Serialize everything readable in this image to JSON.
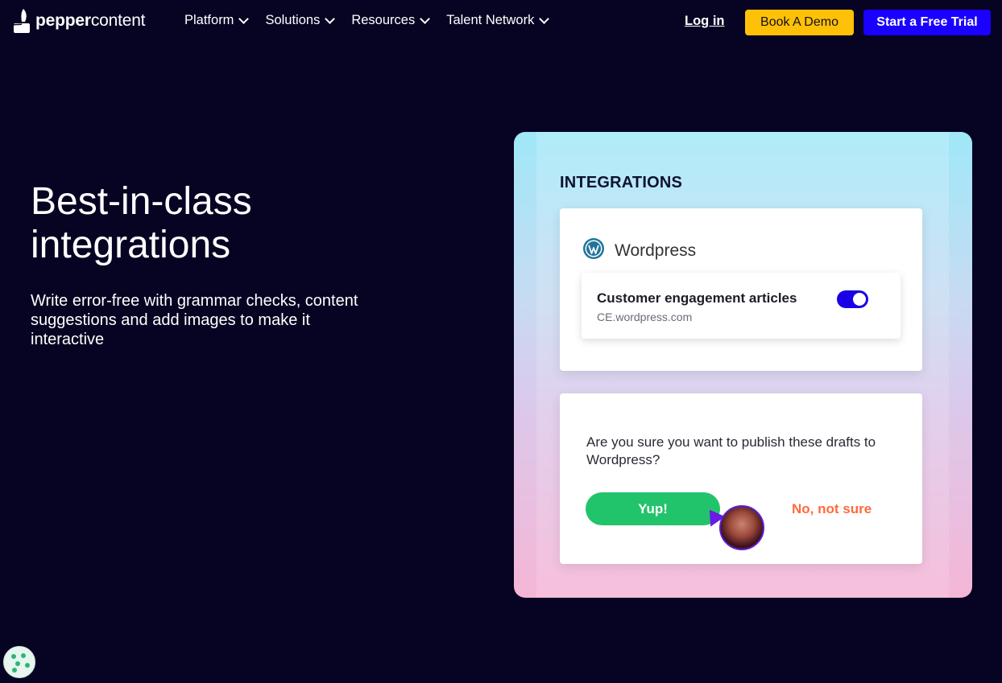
{
  "nav": {
    "logo_bold": "pepper",
    "logo_regular": "content",
    "menu": [
      {
        "label": "Platform"
      },
      {
        "label": "Solutions"
      },
      {
        "label": "Resources"
      },
      {
        "label": "Talent Network"
      }
    ],
    "login_label": "Log in",
    "demo_label": "Book A Demo",
    "trial_label": "Start a Free Trial"
  },
  "hero": {
    "title": "Best-in-class integrations",
    "subtitle": "Write error-free with grammar checks, content suggestions and add images to make it interactive"
  },
  "panel": {
    "heading": "INTEGRATIONS",
    "integration_name": "Wordpress",
    "site_title": "Customer engagement articles",
    "site_url": "CE.wordpress.com",
    "toggle_on": true,
    "question": "Are you sure you want to publish these drafts to Wordpress?",
    "yes_label": "Yup!",
    "no_label": "No, not sure"
  },
  "colors": {
    "background": "#070322",
    "demo_button": "#ffc107",
    "trial_button": "#1a00ff",
    "toggle": "#1a00e6",
    "yes_button": "#22c46b",
    "no_text": "#ff6a3d",
    "wordpress_logo": "#21759b"
  },
  "icons": {
    "logo": "pen-nib-icon",
    "menu_caret": "chevron-down-icon",
    "wordpress": "wordpress-icon",
    "cookie": "cookie-icon"
  }
}
